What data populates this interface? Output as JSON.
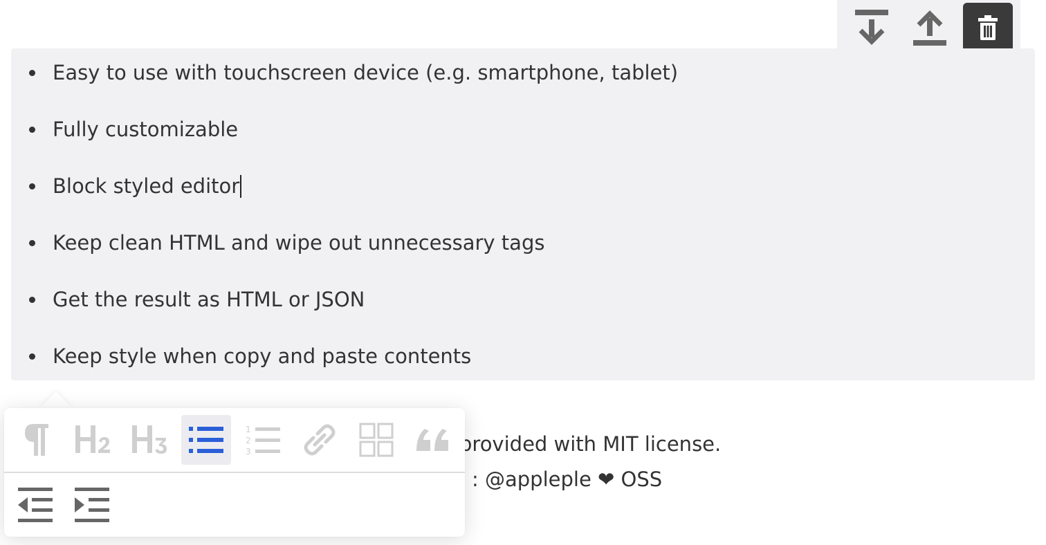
{
  "block_controls": {
    "move_down_icon": "arrow-down-to-bar-icon",
    "move_up_icon": "arrow-up-from-bar-icon",
    "delete_icon": "trash-icon"
  },
  "block": {
    "items": [
      "Easy to use with touchscreen device (e.g. smartphone, tablet)",
      "Fully customizable",
      "Block styled editor",
      "Keep clean HTML and wipe out unnecessary tags",
      "Get the result as HTML or JSON",
      "Keep style when copy and paste contents"
    ],
    "cursor_item_index": 2
  },
  "background_text": {
    "line1": "provided with MIT license.",
    "line2": ": @appleple ❤ OSS"
  },
  "toolbar": {
    "row1": [
      {
        "name": "paragraph",
        "glyph": "¶",
        "active": false
      },
      {
        "name": "heading-2",
        "glyph": "H₂",
        "active": false
      },
      {
        "name": "heading-3",
        "glyph": "H₃",
        "active": false
      },
      {
        "name": "bulleted-list",
        "active": true
      },
      {
        "name": "numbered-list",
        "active": false
      },
      {
        "name": "link",
        "active": false
      },
      {
        "name": "grid",
        "active": false
      },
      {
        "name": "quote",
        "glyph": "“",
        "active": false
      }
    ],
    "row2": [
      {
        "name": "outdent"
      },
      {
        "name": "indent"
      }
    ]
  },
  "colors": {
    "block_bg": "#f1f1f3",
    "active_accent": "#2b5fd8",
    "icon_gray": "#cfcfcf",
    "dark_icon": "#666666",
    "delete_bg": "#3a3a3a"
  }
}
